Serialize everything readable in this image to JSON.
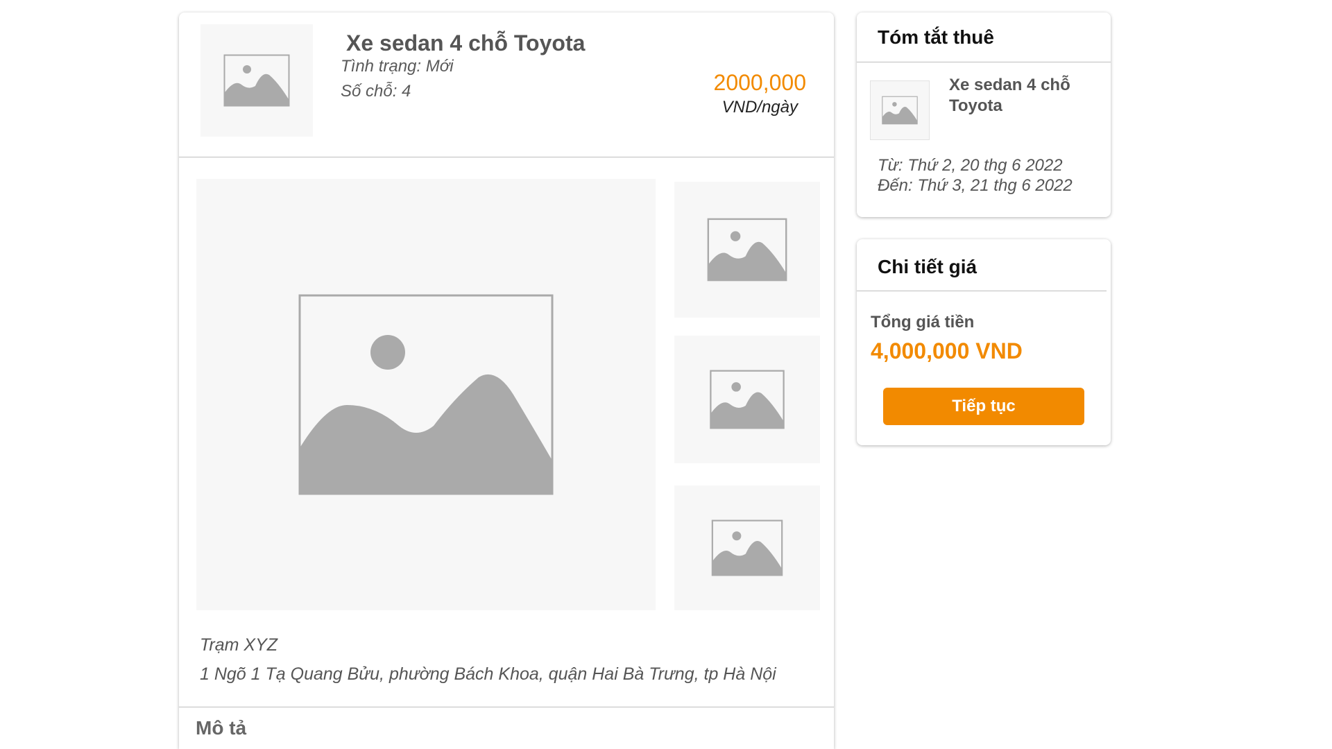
{
  "product": {
    "title": "Xe sedan 4 chỗ Toyota",
    "condition": "Tình trạng: Mới",
    "seats": "Số chỗ: 4",
    "price": "2000,000",
    "price_unit": "VND/ngày",
    "station_name": "Trạm XYZ",
    "station_address": "1 Ngõ 1 Tạ Quang Bửu, phường Bách Khoa, quận Hai Bà Trưng, tp Hà Nội",
    "description_heading": "Mô tả"
  },
  "summary": {
    "heading": "Tóm tắt thuê",
    "car_title": "Xe sedan 4 chỗ Toyota",
    "from": "Từ: Thứ 2, 20 thg 6 2022",
    "to": "Đến: Thứ 3, 21 thg 6 2022"
  },
  "pricing": {
    "heading": "Chi tiết giá",
    "total_label": "Tổng giá tiền",
    "total_value": "4,000,000 VND",
    "continue_label": "Tiếp tục"
  },
  "colors": {
    "accent": "#f28a00",
    "placeholder_bg": "#f7f7f7",
    "placeholder_icon": "#aaaaaa",
    "divider": "#bdbdbd"
  },
  "icons": [
    "image-placeholder-icon"
  ]
}
